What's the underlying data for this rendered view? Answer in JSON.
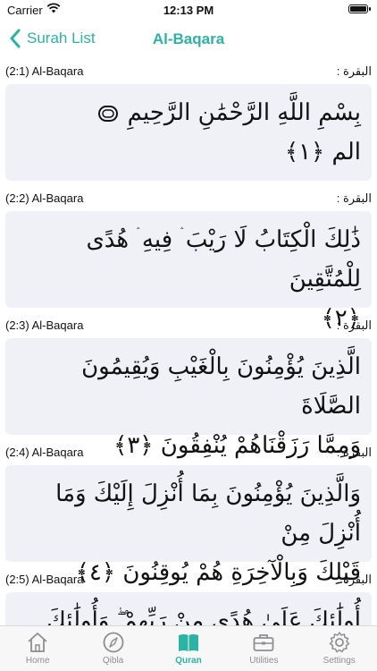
{
  "status": {
    "carrier": "Carrier",
    "time": "12:13 PM"
  },
  "nav": {
    "back_label": "Surah List",
    "title": "Al-Baqara"
  },
  "ayahs": [
    {
      "ref": "(2:1) Al-Baqara",
      "surah_ar": "البقرة :",
      "text": "بِسْمِ اللَّهِ الرَّحْمَٰنِ الرَّحِيمِ",
      "text2": "الم ﴿١﴾"
    },
    {
      "ref": "(2:2) Al-Baqara",
      "surah_ar": "البقرة :",
      "text": "ذَٰلِكَ الْكِتَابُ لَا رَيْبَ ۛ فِيهِ ۛ هُدًى لِلْمُتَّقِينَ",
      "text2": "﴿٢﴾"
    },
    {
      "ref": "(2:3) Al-Baqara",
      "surah_ar": "البقرة :",
      "text": "الَّذِينَ يُؤْمِنُونَ بِالْغَيْبِ وَيُقِيمُونَ الصَّلَاةَ",
      "text2": "وَمِمَّا رَزَقْنَاهُمْ يُنْفِقُونَ ﴿٣﴾"
    },
    {
      "ref": "(2:4) Al-Baqara",
      "surah_ar": "البقرة :",
      "text": "وَالَّذِينَ يُؤْمِنُونَ بِمَا أُنْزِلَ إِلَيْكَ وَمَا أُنْزِلَ مِنْ",
      "text2": "قَبْلِكَ وَبِالْآخِرَةِ هُمْ يُوقِنُونَ ﴿٤﴾"
    },
    {
      "ref": "(2:5) Al-Baqara",
      "surah_ar": "البقرة :",
      "text": "أُولَٰئِكَ عَلَىٰ هُدًى مِنْ رَبِّهِمْ ۖ وَأُولَٰئِكَ هُمُ",
      "text2": ""
    }
  ],
  "tabs": [
    {
      "label": "Home",
      "icon": "home-icon"
    },
    {
      "label": "Qibla",
      "icon": "compass-icon"
    },
    {
      "label": "Quran",
      "icon": "book-icon"
    },
    {
      "label": "Utilities",
      "icon": "briefcase-icon"
    },
    {
      "label": "Settings",
      "icon": "gear-icon"
    }
  ],
  "colors": {
    "accent": "#2bb3a3",
    "card_bg": "#f0f1f6",
    "inactive": "#8e8e93"
  }
}
